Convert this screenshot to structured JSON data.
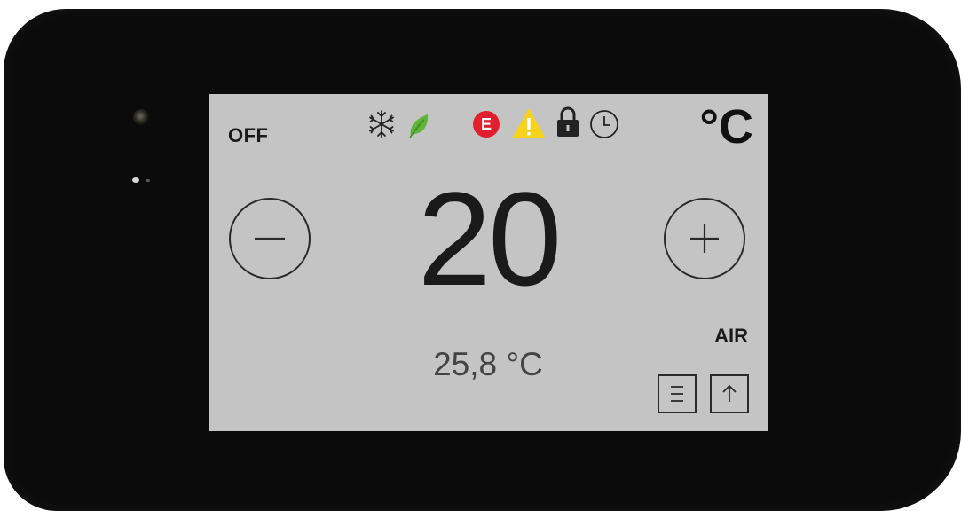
{
  "status": {
    "mode_label": "OFF",
    "unit_label": "°C",
    "icons": [
      "snowflake-icon",
      "leaf-icon",
      "error-icon",
      "warning-icon",
      "lock-icon",
      "clock-icon"
    ],
    "error_letter": "E",
    "warning_symbol": "!"
  },
  "thermostat": {
    "setpoint": "20",
    "measured_temperature": "25,8 °C",
    "sensor_label": "AIR"
  },
  "colors": {
    "screen_background": "#c4c4c4",
    "leaf_green": "#5fb43a",
    "error_red": "#e0202e",
    "warning_yellow": "#f7d21a",
    "device_body": "#0b0b0b"
  }
}
